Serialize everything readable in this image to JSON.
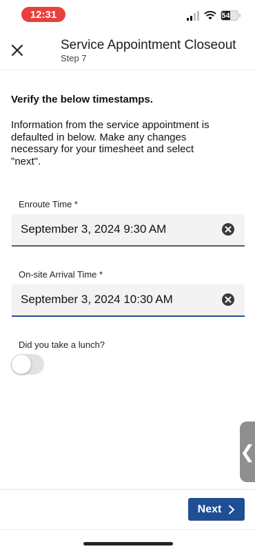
{
  "status_bar": {
    "time": "12:31",
    "battery": "54",
    "battery_level": 0.54,
    "icons": [
      "signal-icon",
      "wifi-icon",
      "battery-icon"
    ],
    "time_pill_color": "#e8403c"
  },
  "header": {
    "title": "Service Appointment Closeout",
    "step": "Step 7",
    "close_icon": "close-icon"
  },
  "content": {
    "heading": "Verify the below timestamps.",
    "intro": "Information from the service appointment is\ndefaulted in below.  Make any changes\nnecessary for your timesheet and select\n\"next\"."
  },
  "fields": [
    {
      "label": "Enroute Time *",
      "value": "September 3, 2024 9:30 AM",
      "clear_icon": "clear-circle-icon",
      "focused": false
    },
    {
      "label": "On-site Arrival Time *",
      "value": "September 3, 2024 10:30 AM",
      "clear_icon": "clear-circle-icon",
      "focused": true
    }
  ],
  "lunch": {
    "label": "Did you take a lunch?",
    "toggle_on": false
  },
  "side_handle": {
    "icon": "chevron-left-icon"
  },
  "footer": {
    "next_label": "Next",
    "next_icon": "chevron-right-icon",
    "accent_color": "#1f4e94"
  }
}
